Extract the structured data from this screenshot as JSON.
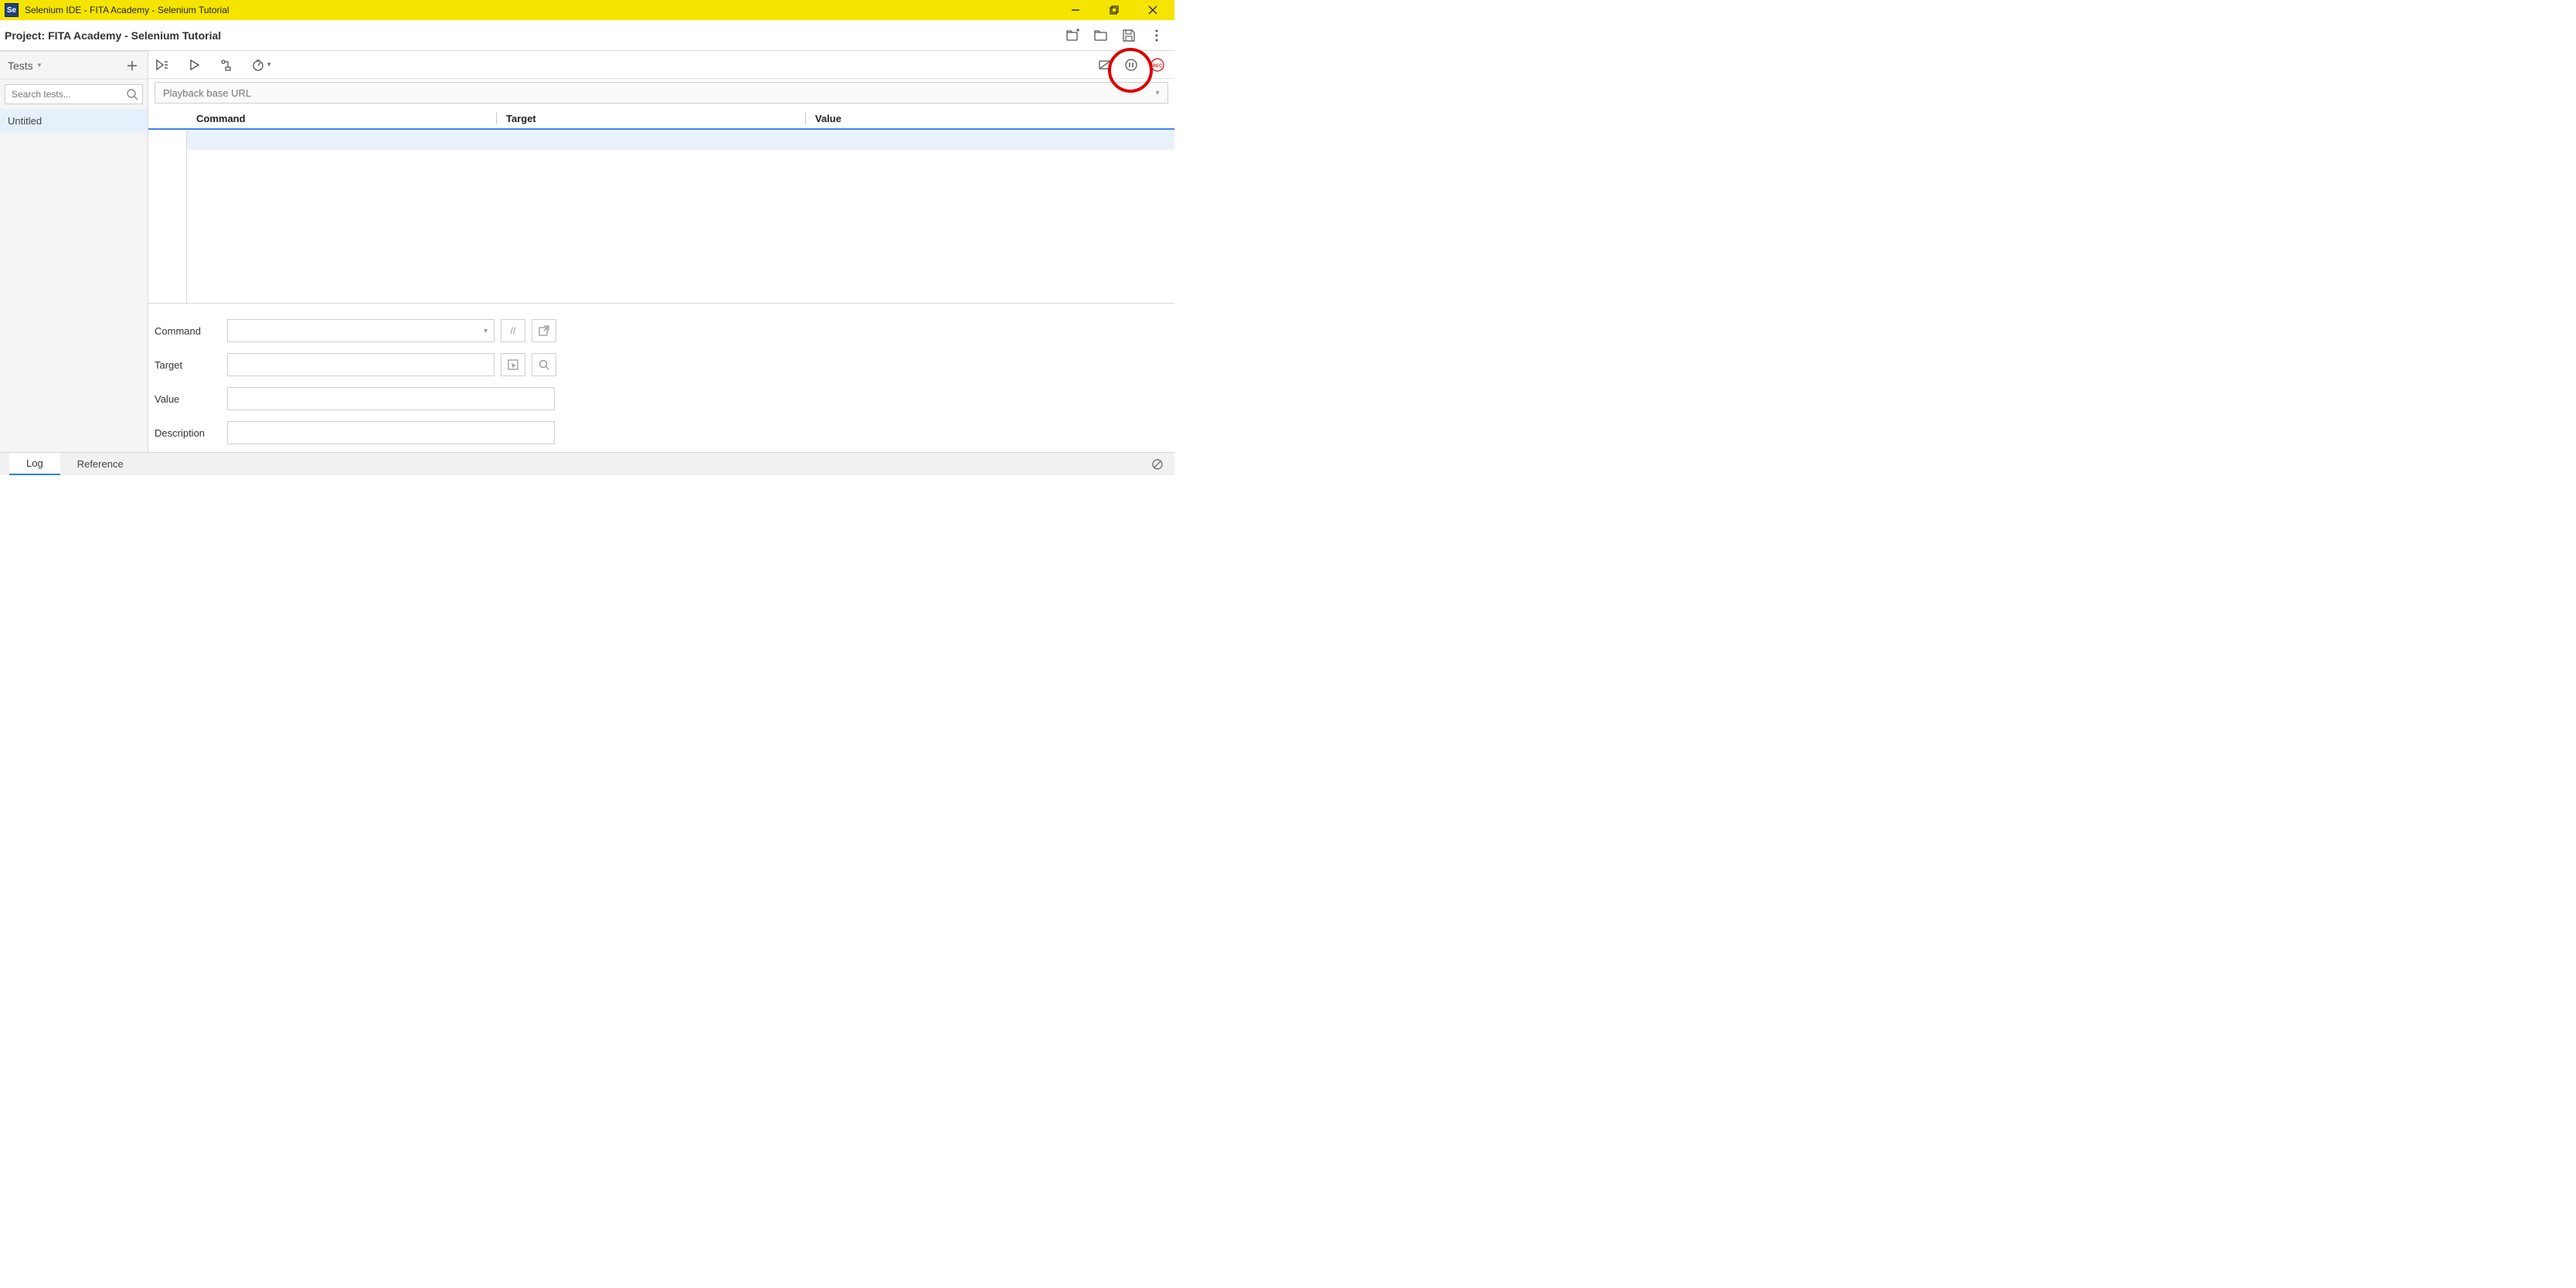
{
  "window": {
    "app_icon_text": "Se",
    "title": "Selenium IDE - FITA Academy - Selenium Tutorial"
  },
  "project": {
    "label": "Project:",
    "name": "FITA Academy - Selenium Tutorial"
  },
  "sidebar": {
    "dropdown_label": "Tests",
    "search_placeholder": "Search tests...",
    "tests": [
      {
        "name": "Untitled"
      }
    ]
  },
  "playback": {
    "url_placeholder": "Playback base URL"
  },
  "columns": {
    "command": "Command",
    "target": "Target",
    "value": "Value"
  },
  "editor_fields": {
    "command": "Command",
    "target": "Target",
    "value": "Value",
    "description": "Description",
    "toggle_comment_symbol": "//"
  },
  "bottom_tabs": {
    "log": "Log",
    "reference": "Reference"
  }
}
